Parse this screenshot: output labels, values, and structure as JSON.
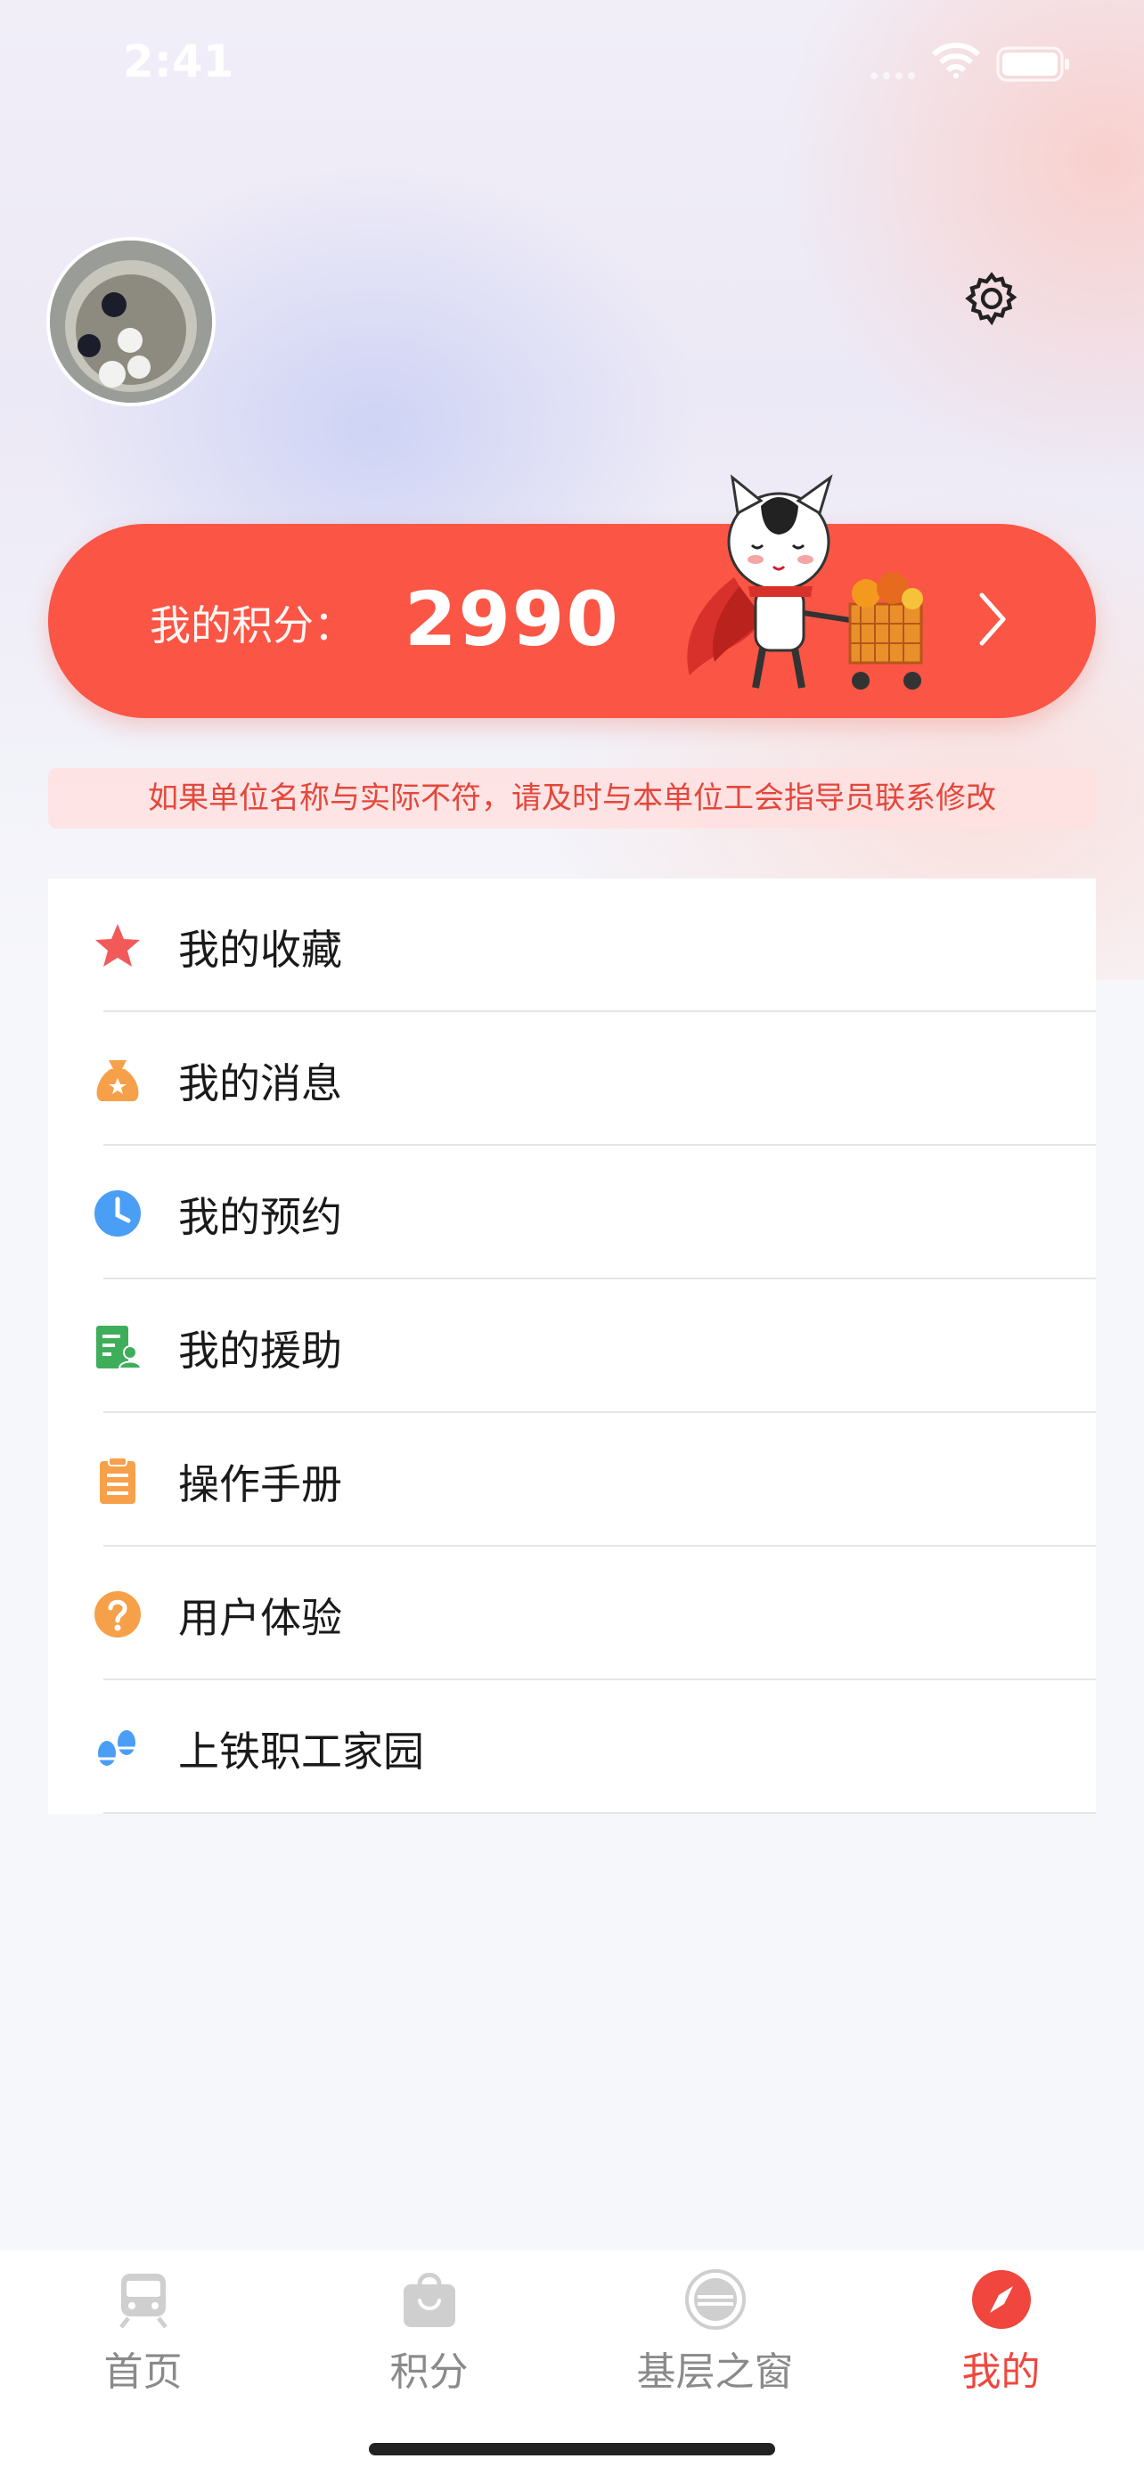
{
  "status_bar": {
    "time": "2:41"
  },
  "profile": {
    "avatar_alt": "avatar"
  },
  "points": {
    "label": "我的积分：",
    "value": "2990"
  },
  "notice": "如果单位名称与实际不符，请及时与本单位工会指导员联系修改",
  "menu": [
    {
      "label": "我的收藏",
      "icon": "star-icon",
      "color": "#f25a5a"
    },
    {
      "label": "我的消息",
      "icon": "money-bag-icon",
      "color": "#f7a04a"
    },
    {
      "label": "我的预约",
      "icon": "clock-icon",
      "color": "#4a9ef5"
    },
    {
      "label": "我的援助",
      "icon": "document-person-icon",
      "color": "#3fae5a"
    },
    {
      "label": "操作手册",
      "icon": "clipboard-icon",
      "color": "#f7a04a"
    },
    {
      "label": "用户体验",
      "icon": "question-icon",
      "color": "#f7a04a"
    },
    {
      "label": "上铁职工家园",
      "icon": "footprints-icon",
      "color": "#4a9ef5"
    }
  ],
  "tabbar": [
    {
      "label": "首页",
      "icon": "train-icon",
      "active": false
    },
    {
      "label": "积分",
      "icon": "shopping-bag-icon",
      "active": false
    },
    {
      "label": "基层之窗",
      "icon": "railway-emblem-icon",
      "active": false
    },
    {
      "label": "我的",
      "icon": "compass-icon",
      "active": true
    }
  ],
  "colors": {
    "accent": "#fb5545",
    "active_tab": "#f0463e",
    "notice_text": "#e4473b"
  }
}
